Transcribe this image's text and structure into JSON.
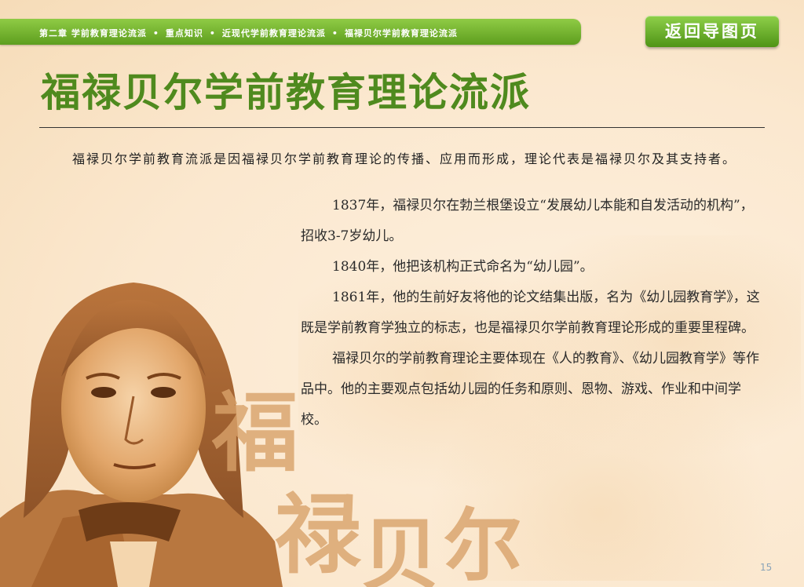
{
  "header": {
    "breadcrumb": [
      "第二章 学前教育理论流派",
      "重点知识",
      "近现代学前教育理论流派",
      "福禄贝尔学前教育理论流派"
    ],
    "back_button_label": "返回导图页"
  },
  "title": "福禄贝尔学前教育理论流派",
  "intro": "福禄贝尔学前教育流派是因福禄贝尔学前教育理论的传播、应用而形成，理论代表是福禄贝尔及其支持者。",
  "paragraphs": [
    "1837年，福禄贝尔在勃兰根堡设立“发展幼儿本能和自发活动的机构”，招收3-7岁幼儿。",
    "1840年，他把该机构正式命名为“幼儿园”。",
    "1861年，他的生前好友将他的论文结集出版，名为《幼儿园教育学》，这既是学前教育学独立的标志，也是福禄贝尔学前教育理论形成的重要里程碑。",
    "福禄贝尔的学前教育理论主要体现在《人的教育》、《幼儿园教育学》等作品中。他的主要观点包括幼儿园的任务和原则、恩物、游戏、作业和中间学校。"
  ],
  "calligraphy": [
    "福",
    "禄",
    "贝",
    "尔"
  ],
  "page_number": "15",
  "colors": {
    "accent_green": "#4f8a1e",
    "bar_green": "#7cbd34",
    "sepia": "#c98a4a",
    "background": "#fbe8cf"
  }
}
